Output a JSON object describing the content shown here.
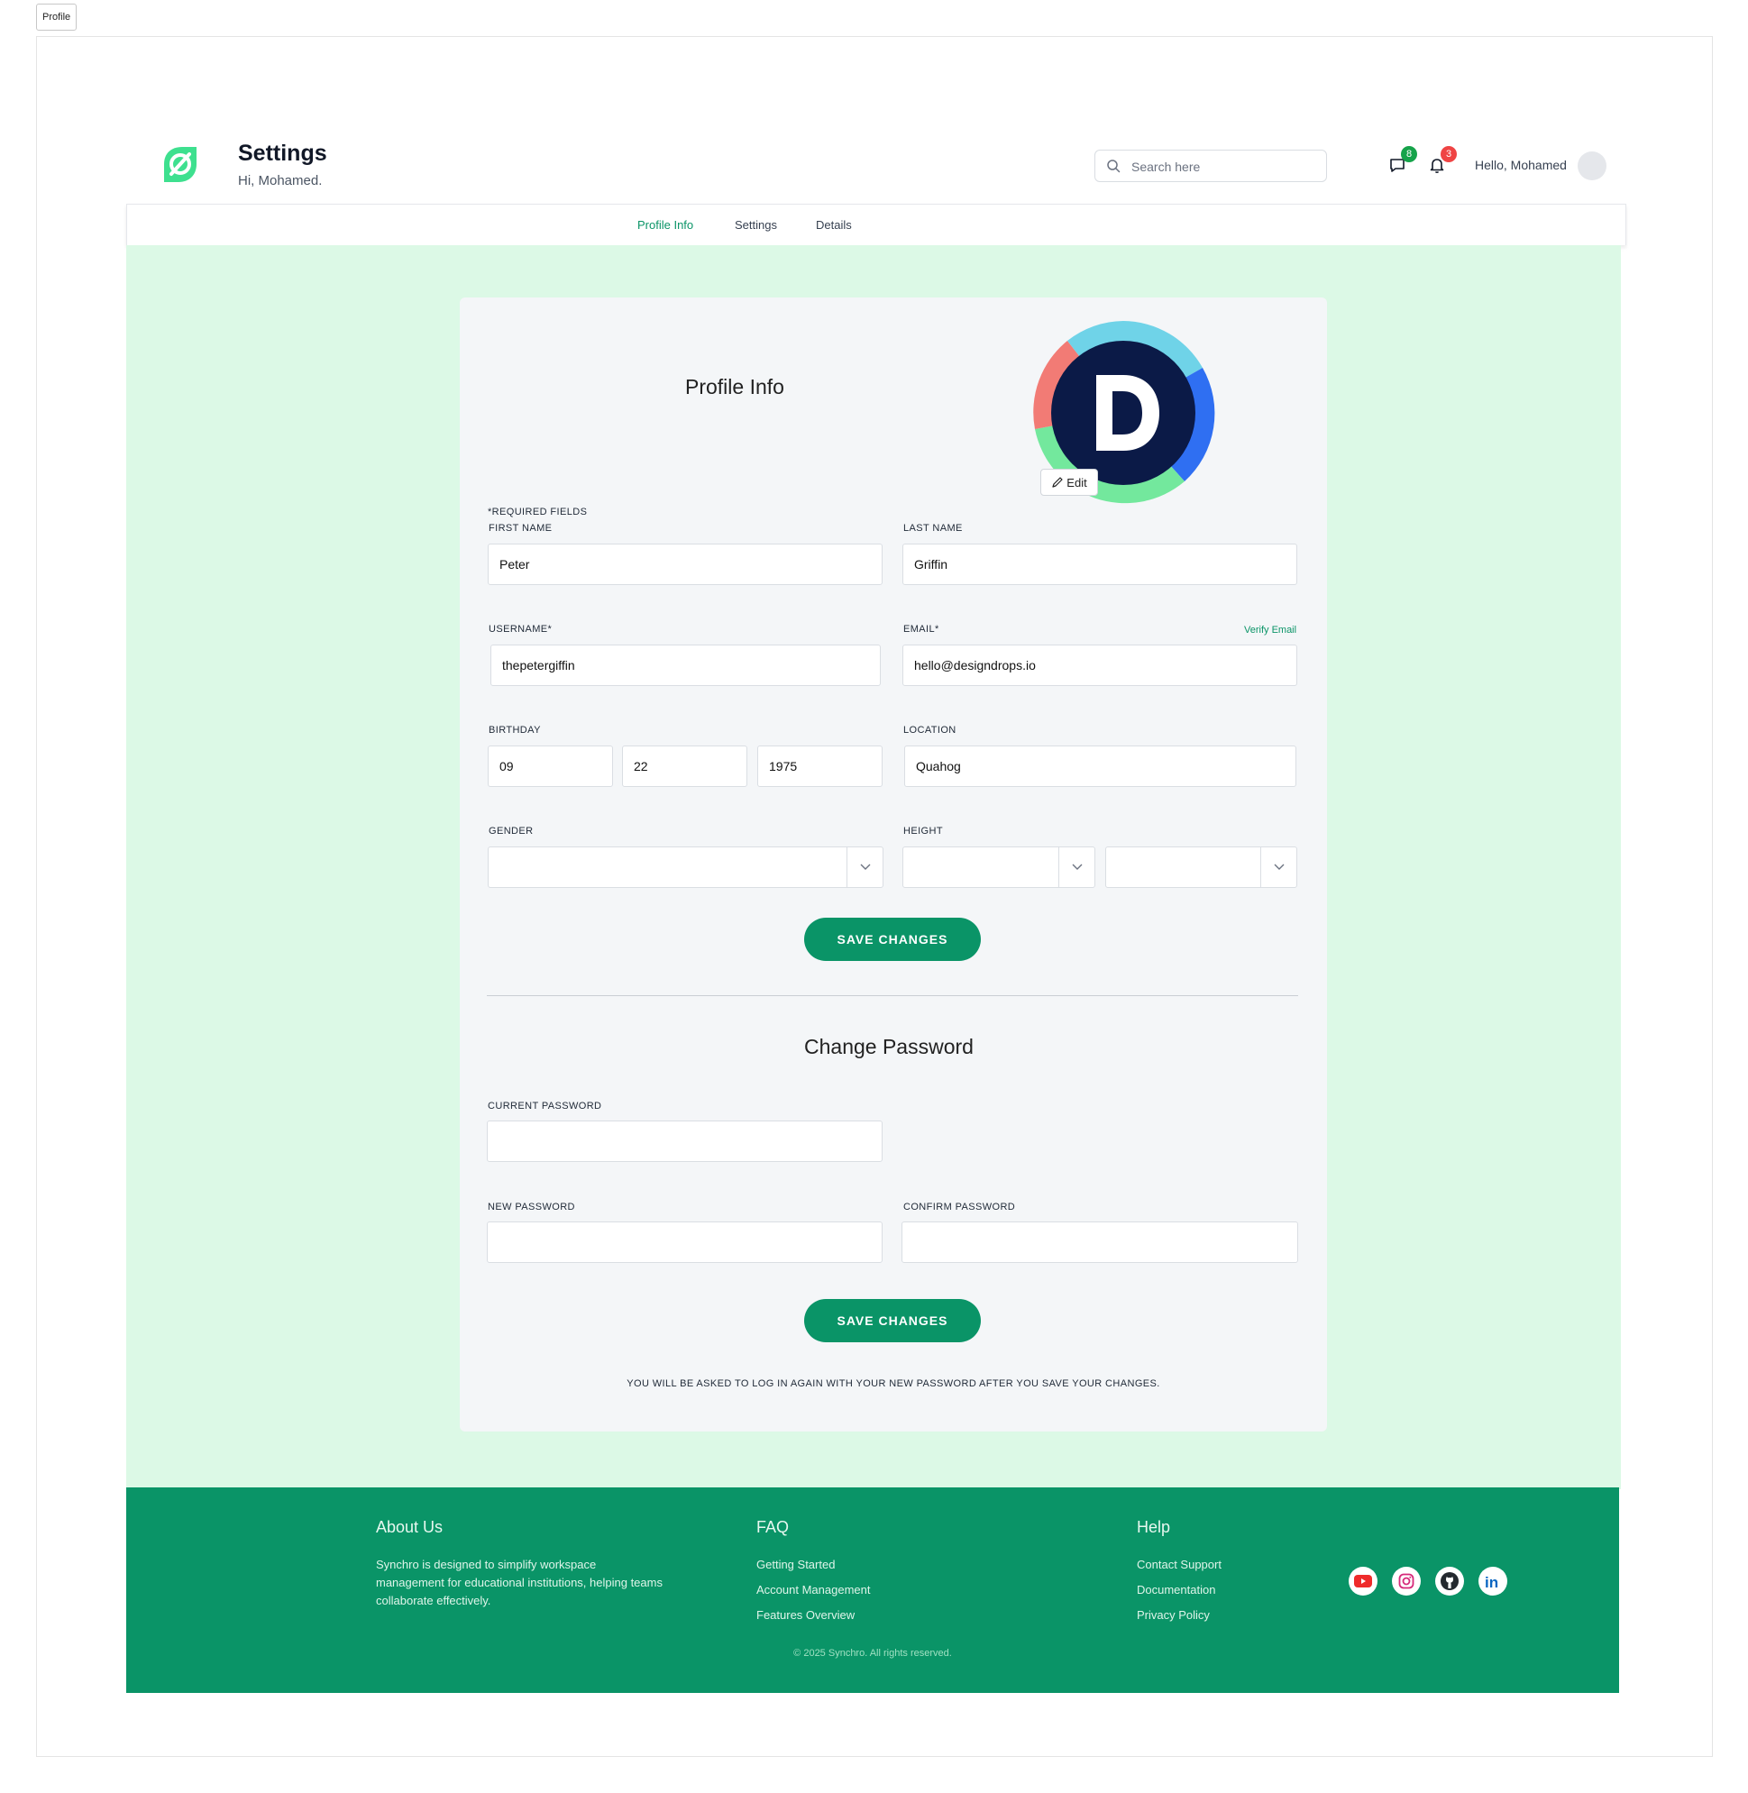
{
  "browser_tab": {
    "label": "Profile"
  },
  "header": {
    "title": "Settings",
    "subtitle": "Hi, Mohamed.",
    "search_placeholder": "Search here",
    "messages_badge": "8",
    "notifications_badge": "3",
    "greeting": "Hello, Mohamed"
  },
  "tabs": [
    {
      "label": "Profile Info",
      "active": true
    },
    {
      "label": "Settings",
      "active": false
    },
    {
      "label": "Details",
      "active": false
    }
  ],
  "profile": {
    "title": "Profile Info",
    "edit_label": "Edit",
    "required_note": "*REQUIRED FIELDS",
    "first_name_label": "FIRST NAME",
    "first_name": "Peter",
    "last_name_label": "LAST NAME",
    "last_name": "Griffin",
    "username_label": "USERNAME*",
    "username": "thepetergiffin",
    "email_label": "EMAIL*",
    "email": "hello@designdrops.io",
    "verify_email": "Verify Email",
    "birthday_label": "BIRTHDAY",
    "birthday_month": "09",
    "birthday_day": "22",
    "birthday_year": "1975",
    "location_label": "LOCATION",
    "location": "Quahog",
    "gender_label": "GENDER",
    "height_label": "HEIGHT",
    "save_label": "SAVE CHANGES"
  },
  "password": {
    "title": "Change Password",
    "current_label": "CURRENT PASSWORD",
    "new_label": "NEW PASSWORD",
    "confirm_label": "CONFIRM PASSWORD",
    "save_label": "SAVE CHANGES",
    "note": "YOU WILL BE ASKED TO LOG IN AGAIN WITH YOUR NEW PASSWORD AFTER YOU SAVE YOUR CHANGES."
  },
  "footer": {
    "about_title": "About Us",
    "about_text": "Synchro is designed to simplify workspace management for educational institutions, helping teams collaborate effectively.",
    "faq_title": "FAQ",
    "faq_links": [
      "Getting Started",
      "Account Management",
      "Features Overview"
    ],
    "help_title": "Help",
    "help_links": [
      "Contact Support",
      "Documentation",
      "Privacy Policy"
    ],
    "social_icons": [
      "youtube-icon",
      "instagram-icon",
      "github-icon",
      "linkedin-icon"
    ],
    "copyright": "© 2025 Synchro. All rights reserved."
  },
  "colors": {
    "accent": "#0a9467",
    "main_background": "#dcf9e6",
    "card_background": "#f4f6f8",
    "messages_badge": "#16a34a",
    "notifications_badge": "#ef4444"
  }
}
